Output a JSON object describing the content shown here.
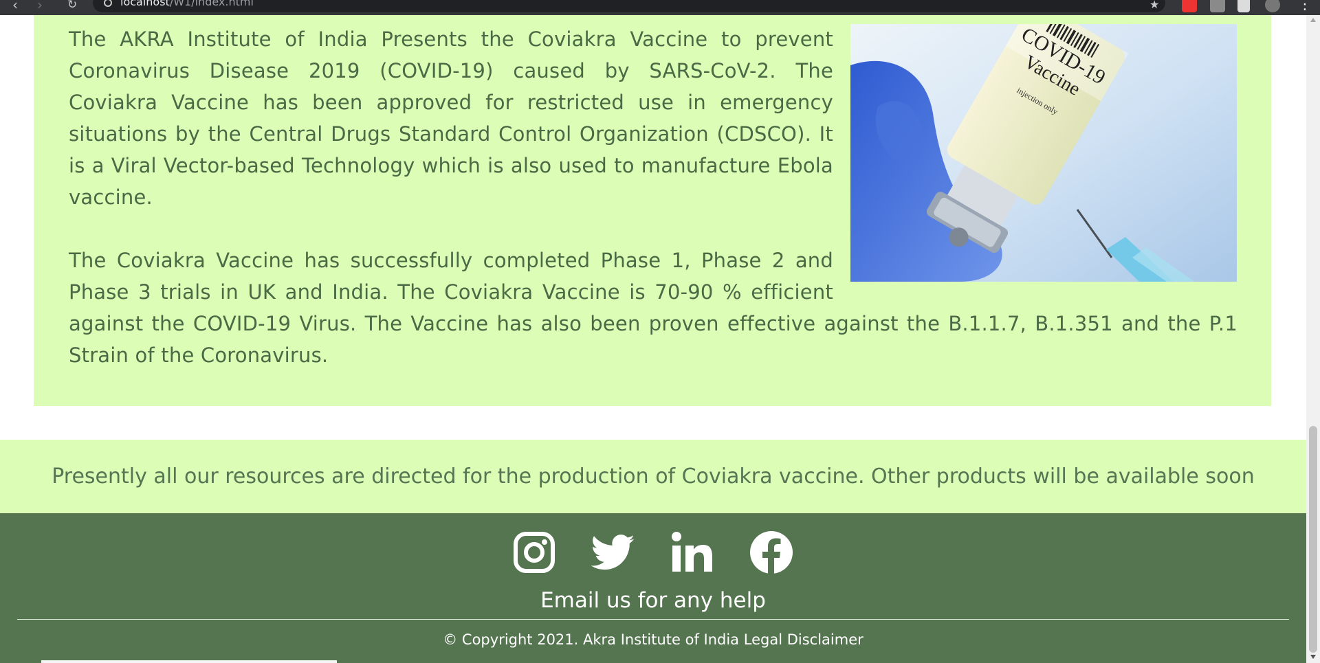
{
  "browser": {
    "url_host": "localhost",
    "url_path": "/W1/index.html"
  },
  "intro": {
    "paragraph_1": "The AKRA Institute of India Presents the Coviakra Vaccine to prevent Coronavirus Disease 2019 (COVID-19) caused by SARS-CoV-2. The Coviakra Vaccine has been approved for restricted use in emergency situations by the Central Drugs Standard Control Organization (CDSCO). It is a Viral Vector-based Technology which is also used to manufacture Ebola vaccine.",
    "paragraph_2": "The Coviakra Vaccine has successfully completed Phase 1, Phase 2 and Phase 3 trials in UK and India. The Coviakra Vaccine is 70-90 % efficient against the COVID-19 Virus. The Vaccine has also been proven effective against the B.1.1.7, B.1.351 and the P.1 Strain of the Coronavirus.",
    "image_label_line1": "COVID-19",
    "image_label_line2": "Vaccine",
    "image_label_small": "injection only"
  },
  "notice": {
    "text": "Presently all our resources are directed for the production of Coviakra vaccine. Other products will be available soon"
  },
  "footer": {
    "socials": [
      {
        "name": "instagram",
        "icon": "instagram-icon"
      },
      {
        "name": "twitter",
        "icon": "twitter-icon"
      },
      {
        "name": "linkedin",
        "icon": "linkedin-icon"
      },
      {
        "name": "facebook",
        "icon": "facebook-icon"
      }
    ],
    "help_text": "Email us for any help",
    "copyright": "© Copyright 2021. Akra Institute of India",
    "legal_link": "Legal Disclaimer"
  },
  "colors": {
    "panel_bg": "#dbfdb5",
    "body_text": "#4a6a45",
    "footer_bg": "#54754f",
    "footer_text": "#ffffff"
  }
}
